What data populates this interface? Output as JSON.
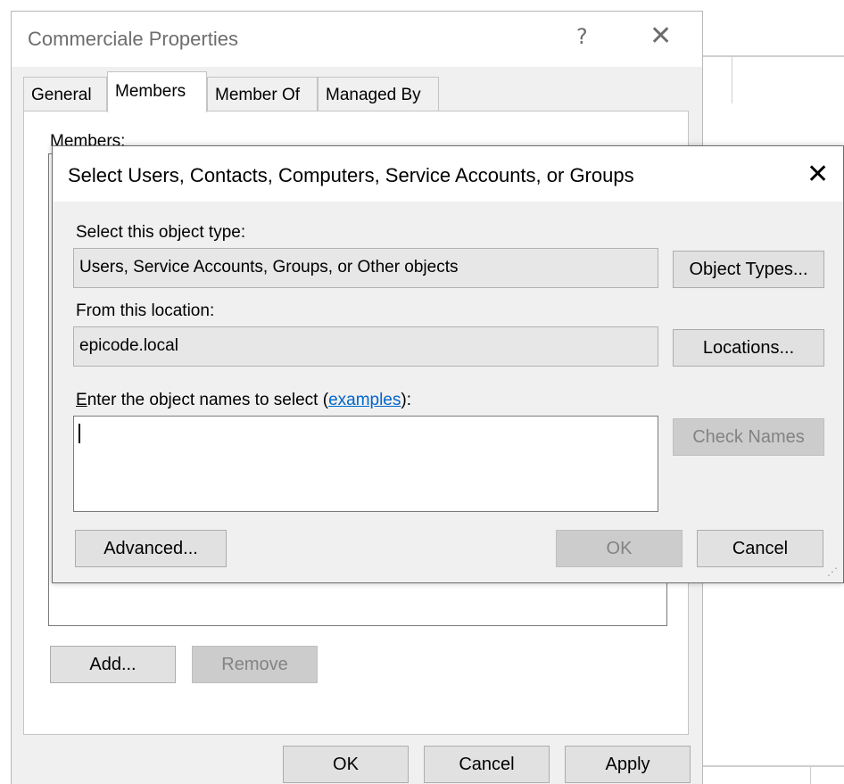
{
  "properties_window": {
    "title": "Commerciale Properties",
    "help": "?",
    "close": "✕",
    "tabs": [
      "General",
      "Members",
      "Member Of",
      "Managed By"
    ],
    "members_label": "Members:",
    "add_button": "Add...",
    "remove_button": "Remove",
    "ok_button": "OK",
    "cancel_button": "Cancel",
    "apply_button": "Apply"
  },
  "select_dialog": {
    "title": "Select Users, Contacts, Computers, Service Accounts, or Groups",
    "close": "✕",
    "object_type_label": "Select this object type:",
    "object_type_value": "Users, Service Accounts, Groups, or Other objects",
    "object_types_button": "Object Types...",
    "location_label": "From this location:",
    "location_value": "epicode.local",
    "locations_button": "Locations...",
    "names_label_first": "E",
    "names_label_rest": "nter the object names to select (",
    "names_label_link": "examples",
    "names_label_end": "):",
    "names_value": "",
    "check_names_button": "Check Names",
    "advanced_button": "Advanced...",
    "ok_button": "OK",
    "cancel_button": "Cancel"
  }
}
